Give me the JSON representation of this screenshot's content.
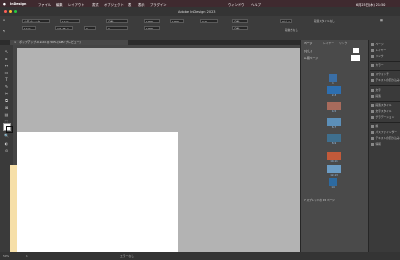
{
  "menubar": {
    "items": [
      "InDesign",
      "ファイル",
      "編集",
      "レイアウト",
      "書式",
      "オブジェクト",
      "表",
      "表示",
      "プラグイン",
      "ウィンドウ",
      "ヘルプ"
    ],
    "clock": "6月25日(木) 21:50"
  },
  "window": {
    "title": "Adobe InDesign 2023"
  },
  "control": {
    "font_size": "12 Q",
    "line": "(21.75 ≤",
    "auto": "自動",
    "zero1": "0",
    "zero2": "0",
    "h100": "100%",
    "v100": "100%",
    "pct": "100%",
    "zero_h": "0 H",
    "style_name": "[なし]",
    "char_style": "段落スタイルなし",
    "span_label": "段抜きなし"
  },
  "document_tab": {
    "label": "ポップアップ-0.indd @ 50% [GPU プレビュー]",
    "close": "×"
  },
  "tools": [
    "↖",
    "▸",
    "↔",
    "▭",
    "T",
    "✎",
    "✂",
    "⧉",
    "⊠",
    "▤",
    "⬚",
    "✋",
    "🔍",
    "◐",
    "⊙"
  ],
  "pages_panel": {
    "tabs": [
      "ページ",
      "レイヤー",
      "リンク"
    ],
    "none_label": "[なし]",
    "master_label": "A-親ページ",
    "spreads": [
      {
        "label": "1",
        "color": "#3a6ea5"
      },
      {
        "label": "2-3",
        "color": "#2e6fb0"
      },
      {
        "label": "4-5",
        "color": "#a86b5c"
      },
      {
        "label": "6-7",
        "color": "#5c8fb8"
      },
      {
        "label": "8-9",
        "color": "#3f6f8e"
      },
      {
        "label": "10-11",
        "color": "#c25a3a"
      },
      {
        "label": "12-13",
        "color": "#6c9cc4"
      },
      {
        "label": "14",
        "color": "#2d6aa0"
      }
    ],
    "footer": "7 スプレッドの 15 ページ"
  },
  "right_dock": [
    {
      "label": "ページ"
    },
    {
      "label": "レイヤー"
    },
    {
      "label": "リンク"
    },
    {
      "label": "カラー"
    },
    {
      "label": "スウォッチ"
    },
    {
      "label": "テキストの回り込み"
    },
    {
      "label": "文字"
    },
    {
      "label": "段落"
    },
    {
      "label": "段落スタイル"
    },
    {
      "label": "文字スタイル"
    },
    {
      "label": "グラデーション"
    },
    {
      "label": "線"
    },
    {
      "label": "パスファインダー"
    },
    {
      "label": "テキストの回り込み"
    },
    {
      "label": "情報"
    }
  ],
  "status": {
    "zoom": "50%",
    "page": "1",
    "errors": "エラーなし"
  }
}
